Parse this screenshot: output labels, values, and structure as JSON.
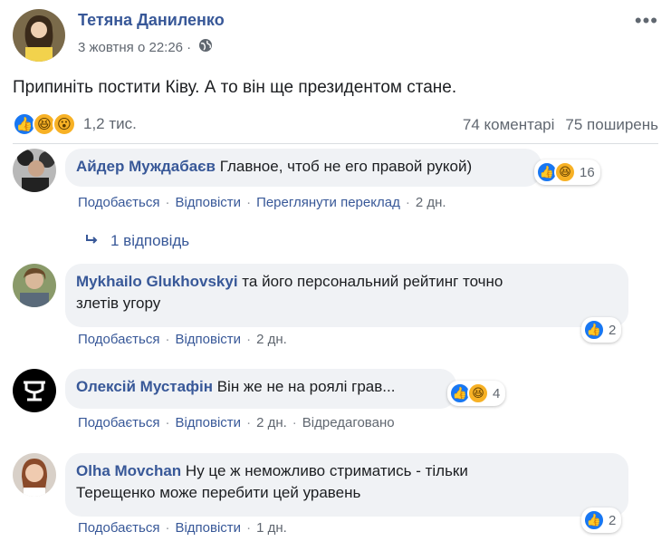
{
  "post": {
    "author": "Тетяна Даниленко",
    "time": "3 жовтня о 22:26 ·",
    "text": "Припиніть постити Ківу. А то він ще президентом стане.",
    "reaction_count": "1,2 тис.",
    "comments": "74 коментарі",
    "shares": "75 поширень"
  },
  "labels": {
    "like": "Подобається",
    "reply": "Відповісти",
    "translate": "Переглянути переклад",
    "edited": "Відредаговано"
  },
  "comments": [
    {
      "name": "Айдер Муждабаєв",
      "text": "Главное, чтоб не его правой рукой)",
      "reactions": "16",
      "time": "2 дн."
    },
    {
      "name": "Mykhailo Glukhovskyi",
      "text": "та його персональний рейтинг точно",
      "text2": "злетів угору",
      "reactions": "2",
      "time": "2 дн."
    },
    {
      "name": "Олексій Мустафін",
      "text": "Він же не на роялі грав...",
      "reactions": "4",
      "time": "2 дн."
    },
    {
      "name": "Olha Movchan",
      "text": "Ну це ж неможливо стриматись - тільки",
      "text2": "Терещенко може перебити цей уравень",
      "reactions": "2",
      "time": "1 дн."
    }
  ],
  "replies": {
    "label": "1 відповідь"
  },
  "colors": {
    "link": "#385898",
    "like_blue": "#1877f2",
    "haha_yellow": "#f7b125",
    "bubble": "#f0f2f5"
  },
  "icons": [
    "avatar",
    "globe-icon",
    "more-icon",
    "like-icon",
    "haha-icon",
    "wow-icon",
    "reply-arrow-icon",
    "organization-logo"
  ]
}
